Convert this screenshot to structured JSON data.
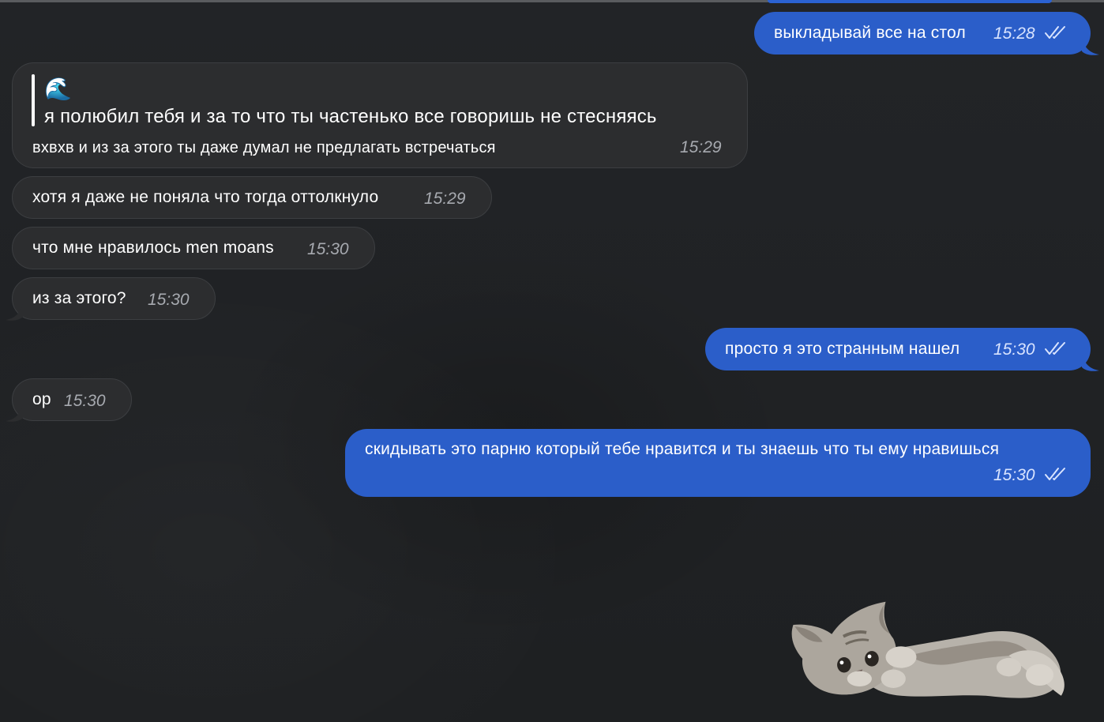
{
  "messages": [
    {
      "direction": "out",
      "text": "выкладывай все на стол",
      "time": "15:28",
      "status": "read"
    },
    {
      "direction": "in",
      "quote": {
        "emoji": "🌊",
        "text": "я полюбил тебя и за то что ты частенько все говоришь не стесняясь"
      },
      "text": "вхвхв и из за этого ты даже думал не предлагать встречаться",
      "time": "15:29"
    },
    {
      "direction": "in",
      "text": "хотя я даже не поняла что тогда оттолкнуло",
      "time": "15:29"
    },
    {
      "direction": "in",
      "text": "что мне нравилось men moans",
      "time": "15:30"
    },
    {
      "direction": "in",
      "text": "из за этого?",
      "time": "15:30"
    },
    {
      "direction": "out",
      "text": "просто я это странным нашел",
      "time": "15:30",
      "status": "read"
    },
    {
      "direction": "in",
      "text": "ор",
      "time": "15:30"
    },
    {
      "direction": "out",
      "text": "скидывать это парню который тебе нравится и ты знаешь что ты ему нравишься",
      "time": "15:30",
      "status": "read"
    }
  ],
  "sticker": {
    "icon": "kitten-sticker"
  },
  "colors": {
    "background": "#1f2123",
    "incoming_bubble": "#2c2d2f",
    "outgoing_bubble": "#2b5ec9",
    "time_incoming": "#a7aab0"
  }
}
